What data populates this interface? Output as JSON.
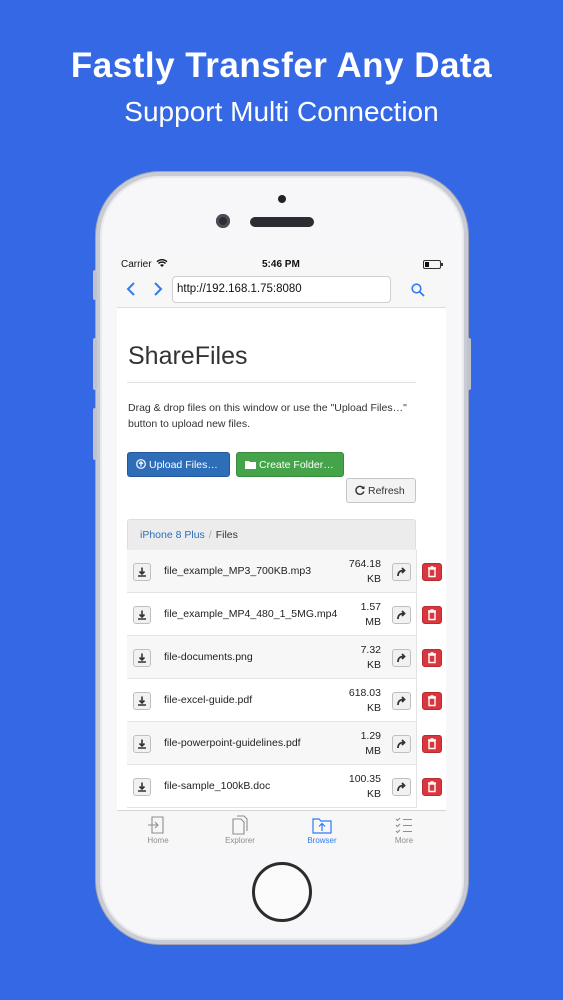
{
  "promo": {
    "headline": "Fastly Transfer Any Data",
    "subline": "Support Multi Connection"
  },
  "status_bar": {
    "carrier": "Carrier",
    "time": "5:46 PM"
  },
  "browser": {
    "url": "http://192.168.1.75:8080",
    "back_icon": "chevron-left-icon",
    "forward_icon": "chevron-right-icon",
    "search_icon": "search-icon"
  },
  "page": {
    "title": "ShareFiles",
    "description": "Drag & drop files on this window or use the \"Upload Files…\" button to upload new files.",
    "upload_label": "Upload Files…",
    "create_folder_label": "Create Folder…",
    "refresh_label": "Refresh",
    "breadcrumb": {
      "device": "iPhone 8 Plus",
      "current": "Files"
    }
  },
  "files": [
    {
      "name": "file_example_MP3_700KB.mp3",
      "size_value": "764.18",
      "size_unit": "KB"
    },
    {
      "name": "file_example_MP4_480_1_5MG.mp4",
      "size_value": "1.57",
      "size_unit": "MB"
    },
    {
      "name": "file-documents.png",
      "size_value": "7.32",
      "size_unit": "KB"
    },
    {
      "name": "file-excel-guide.pdf",
      "size_value": "618.03",
      "size_unit": "KB"
    },
    {
      "name": "file-powerpoint-guidelines.pdf",
      "size_value": "1.29",
      "size_unit": "MB"
    },
    {
      "name": "file-sample_100kB.doc",
      "size_value": "100.35",
      "size_unit": "KB"
    }
  ],
  "tabs": [
    {
      "label": "Home",
      "icon": "home-icon"
    },
    {
      "label": "Explorer",
      "icon": "explorer-icon"
    },
    {
      "label": "Browser",
      "icon": "browser-icon",
      "active": true
    },
    {
      "label": "More",
      "icon": "more-icon"
    }
  ],
  "colors": {
    "background": "#3568e4",
    "primary_button": "#2e6db7",
    "success_button": "#45a34a",
    "danger_button": "#d9363e",
    "tab_active": "#2f7bf6"
  }
}
